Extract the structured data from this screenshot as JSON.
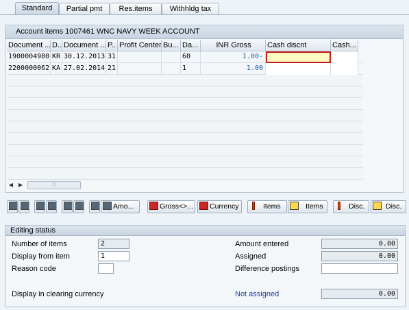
{
  "tabs": [
    "Standard",
    "Partial pmt",
    "Res.items",
    "Withhldg tax"
  ],
  "table": {
    "title": "Account items 1007461 WNC NAVY WEEK ACCOUNT",
    "columns": [
      "Document ...",
      "D..",
      "Document ...",
      "P..",
      "Profit Center",
      "Bu...",
      "Da...",
      "INR Gross",
      "Cash discnt",
      "Cash..."
    ],
    "rows": [
      {
        "doc": "1900004980",
        "dt": "KR",
        "date": "30.12.2013",
        "p": "31",
        "pc": "",
        "bu": "",
        "da": "60",
        "gross": "1.00-",
        "cd": "",
        "cash": ""
      },
      {
        "doc": "2200000062",
        "dt": "KA",
        "date": "27.02.2014",
        "p": "21",
        "pc": "",
        "bu": "",
        "da": "1",
        "gross": "1.00",
        "cd": "",
        "cash": ""
      }
    ]
  },
  "toolbar": {
    "amo": "Amo...",
    "gross": "Gross<>...",
    "currency": "Currency",
    "items1": "Items",
    "items2": "Items",
    "disc1": "Disc.",
    "disc2": "Disc."
  },
  "editing": {
    "title": "Editing status",
    "number_of_items_label": "Number of items",
    "number_of_items": "2",
    "display_from_item_label": "Display from item",
    "display_from_item": "1",
    "reason_code_label": "Reason code",
    "reason_code": "",
    "display_clearing_label": "Display in clearing currency",
    "amount_entered_label": "Amount entered",
    "amount_entered": "0.00",
    "assigned_label": "Assigned",
    "assigned": "0.00",
    "difference_label": "Difference postings",
    "difference": "",
    "not_assigned_label": "Not assigned",
    "not_assigned": "0.00"
  }
}
